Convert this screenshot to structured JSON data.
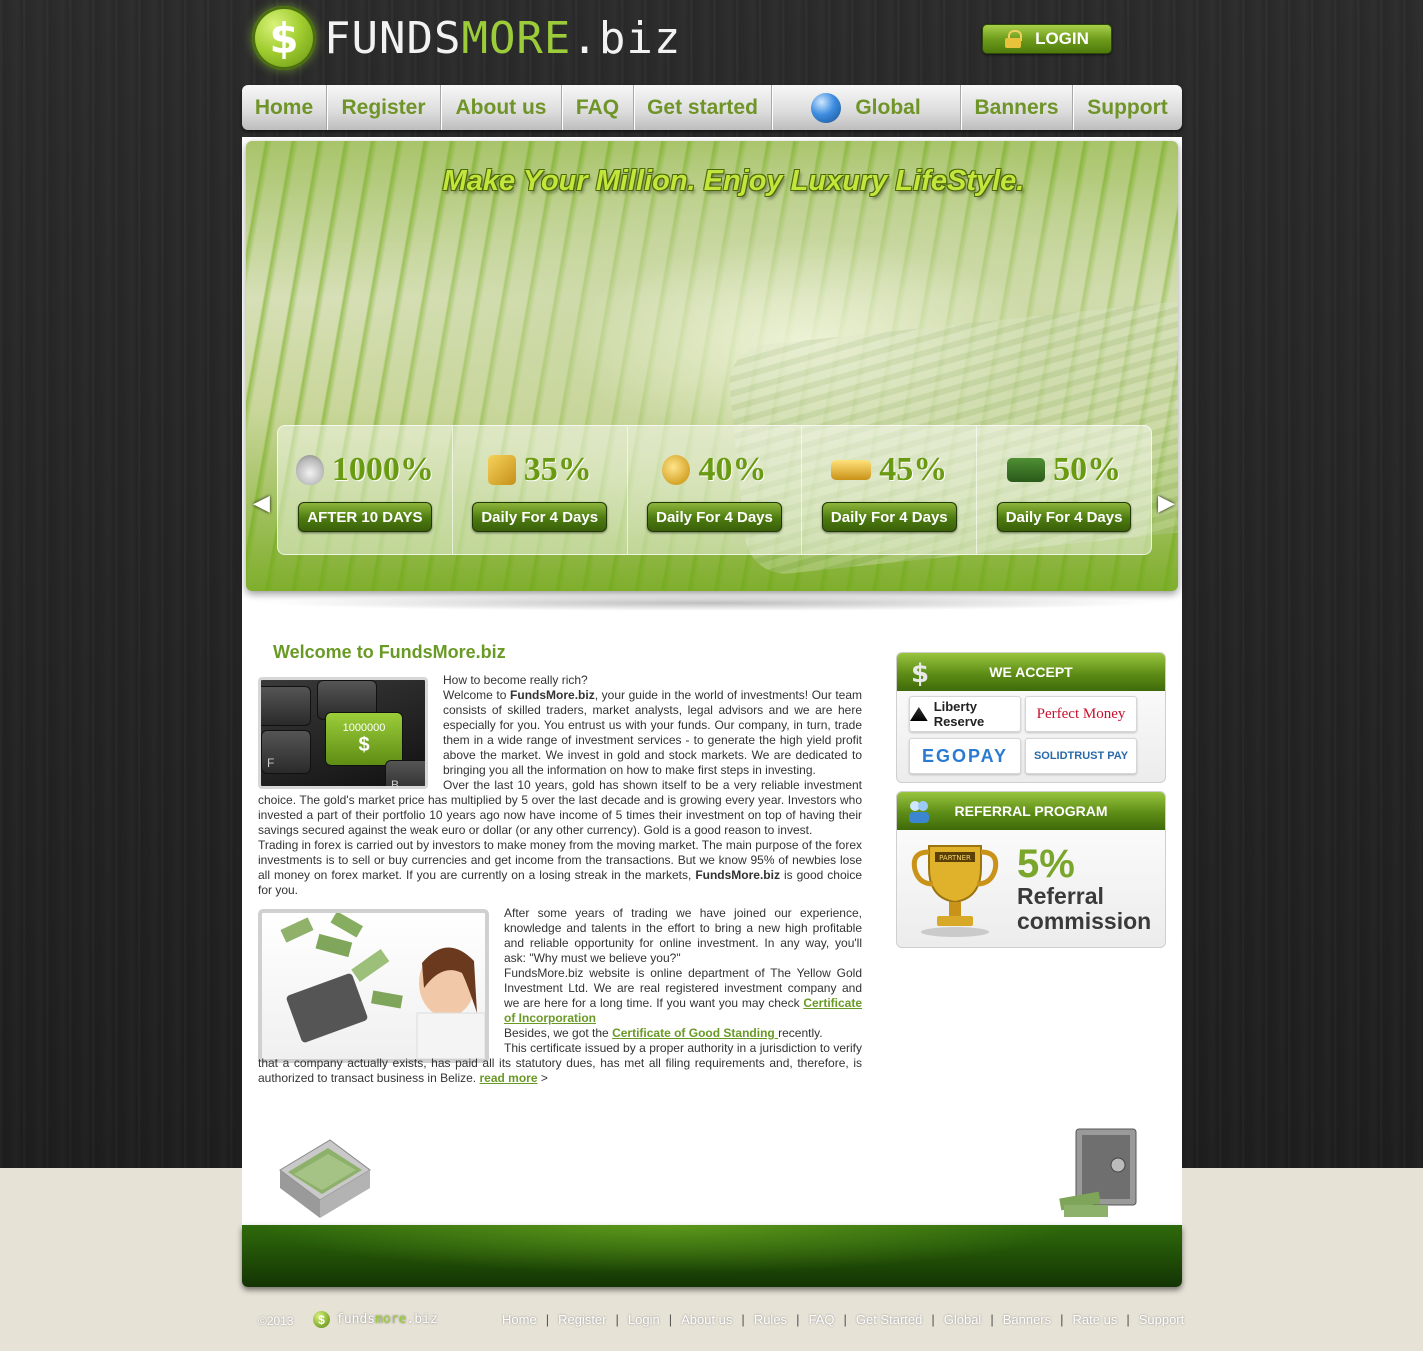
{
  "header": {
    "logo_text_a": "FUNDS",
    "logo_text_b": "MORE",
    "logo_text_c": ".biz",
    "login_label": "LOGIN"
  },
  "nav": {
    "items": [
      "Home",
      "Register",
      "About us",
      "FAQ",
      "Get started",
      "Global",
      "Banners",
      "Support"
    ]
  },
  "banner": {
    "title": "Make Your Million. Enjoy Luxury LifeStyle.",
    "plans": [
      {
        "percent": "1000%",
        "label": "AFTER 10 DAYS",
        "icon": "money-bag-icon"
      },
      {
        "percent": "35%",
        "label": "Daily For 4 Days",
        "icon": "gold-safe-icon"
      },
      {
        "percent": "40%",
        "label": "Daily For 4 Days",
        "icon": "coins-icon"
      },
      {
        "percent": "45%",
        "label": "Daily For 4 Days",
        "icon": "gold-bars-icon"
      },
      {
        "percent": "50%",
        "label": "Daily For 4 Days",
        "icon": "cash-stack-icon"
      }
    ]
  },
  "main": {
    "welcome_title": "Welcome to FundsMore.biz",
    "p1_line1": "How to become really rich?",
    "p1_a": "Welcome to ",
    "p1_brand": "FundsMore.biz",
    "p1_b": ", your guide in the world of investments! Our team consists of skilled traders, market analysts, legal advisors and we are here especially for you. You entrust us with your funds. Our company, in turn, trade them in a wide range of investment services - to generate the high yield profit above the market. We invest in gold and stock markets. We are dedicated to bringing you all the information on how to make first steps in investing.",
    "p2_a": "Over the last 10 years, gold has shown itself to be a very reliable investment choice. The gold's market price has multiplied by 5 over the last decade and is growing every year. Investors who invested a part of their portfolio 10 years ago now have income of 5 times their investment on top of having their savings secured against the weak euro or dollar (or any other currency). Gold is a good reason to invest.",
    "p3_a": "Trading in forex is carried out by investors to make money from the moving market. The main purpose of the forex investments is to sell or buy currencies and get income from the transactions. But we know 95% of newbies lose all money on forex market. If you are currently on a losing streak in the markets, ",
    "p3_brand": "FundsMore.biz",
    "p3_b": " is good choice for you.",
    "p4": "After some years of trading we have joined our experience, knowledge and talents in the effort to bring a new high profitable and reliable opportunity for online investment. In any way, you'll ask: \"Why must we believe you?\"",
    "p5_a": "FundsMore.biz website is online department of The Yellow Gold Investment Ltd. We are real registered investment company and we are here for a long time. If you want you may check ",
    "p5_link": "Certificate of Incorporation",
    "p6_a": "Besides, we got the ",
    "p6_link": "Certificate of Good Standing ",
    "p6_b": "recently.",
    "p7": "This certificate issued by a proper authority in a jurisdiction to verify that a company actually exists, has paid all its statutory dues, has met all filing requirements and, therefore, is authorized to transact business in Belize. ",
    "read_more": "read more",
    "read_more_arrow": " >",
    "keyboard_key_value": "1000000",
    "keyboard_key_symbol": "$",
    "key_f": "F",
    "key_b": "B"
  },
  "sidebar": {
    "accept_title": "WE ACCEPT",
    "payments": [
      "Liberty Reserve",
      "Perfect Money",
      "EGOPAY",
      "SOLIDTRUST PAY"
    ],
    "referral_title": "REFERRAL PROGRAM",
    "referral_percent": "5%",
    "referral_line1": "Referral",
    "referral_line2": "commission",
    "trophy_label": "PARTNER"
  },
  "footer": {
    "copyright": "©2013",
    "logo_a": "funds",
    "logo_b": "more",
    "logo_c": ".biz",
    "links": [
      "Home",
      "Register",
      "Login",
      "About us",
      "Rules",
      "FAQ",
      "Get Started",
      "Global",
      "Banners",
      "Rate us",
      "Support"
    ]
  },
  "colors": {
    "accent_green": "#6a9a26",
    "brand_light_green": "#9ccc3a",
    "background_dark": "#1e1e1e",
    "page_beige": "#e7e2d6"
  }
}
